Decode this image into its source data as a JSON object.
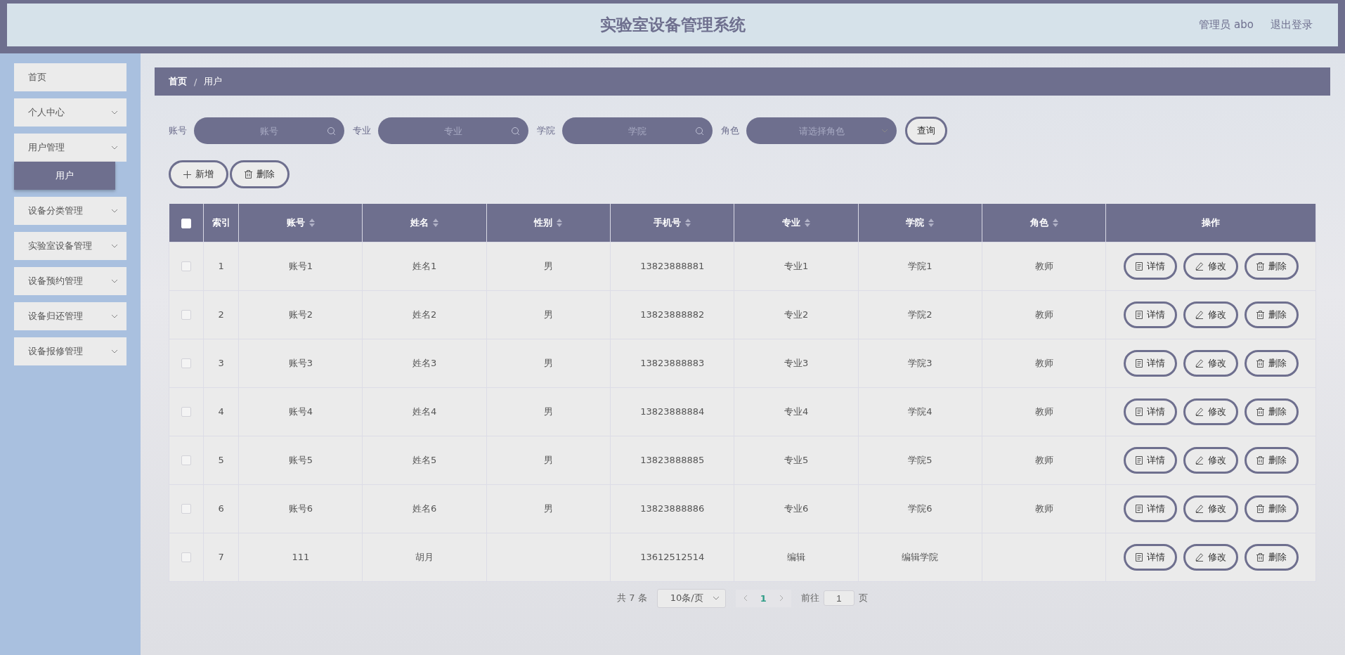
{
  "header": {
    "title": "实验室设备管理系统",
    "user": "管理员 abo",
    "logout": "退出登录"
  },
  "sidebar": {
    "items": [
      {
        "kind": "link",
        "label": "首页"
      },
      {
        "kind": "submenu",
        "label": "个人中心"
      },
      {
        "kind": "submenu",
        "label": "用户管理",
        "children": [
          {
            "label": "用户",
            "selected": true
          }
        ]
      },
      {
        "kind": "submenu",
        "label": "设备分类管理"
      },
      {
        "kind": "submenu",
        "label": "实验室设备管理"
      },
      {
        "kind": "submenu",
        "label": "设备预约管理"
      },
      {
        "kind": "submenu",
        "label": "设备归还管理"
      },
      {
        "kind": "submenu",
        "label": "设备报修管理"
      }
    ]
  },
  "breadcrumb": {
    "items": [
      "首页",
      "用户"
    ],
    "separator": "/"
  },
  "filters": [
    {
      "kind": "text",
      "label": "账号",
      "placeholder": "账号"
    },
    {
      "kind": "text",
      "label": "专业",
      "placeholder": "专业"
    },
    {
      "kind": "text",
      "label": "学院",
      "placeholder": "学院"
    },
    {
      "kind": "select",
      "label": "角色",
      "placeholder": "请选择角色"
    }
  ],
  "search_button": "查询",
  "actions": [
    {
      "kind": "add",
      "label": "新增"
    },
    {
      "kind": "delete",
      "label": "删除"
    }
  ],
  "table": {
    "select_all_checked": false,
    "columns": [
      {
        "label": "索引",
        "sortable": false
      },
      {
        "label": "账号",
        "sortable": true
      },
      {
        "label": "姓名",
        "sortable": true
      },
      {
        "label": "性别",
        "sortable": true
      },
      {
        "label": "手机号",
        "sortable": true
      },
      {
        "label": "专业",
        "sortable": true
      },
      {
        "label": "学院",
        "sortable": true
      },
      {
        "label": "角色",
        "sortable": true
      },
      {
        "label": "操作",
        "sortable": false
      }
    ],
    "rows": [
      {
        "checked": false,
        "cells": [
          "1",
          "账号1",
          "姓名1",
          "男",
          "13823888881",
          "专业1",
          "学院1",
          "教师"
        ],
        "actions": [
          {
            "kind": "detail",
            "label": "详情"
          },
          {
            "kind": "edit",
            "label": "修改"
          },
          {
            "kind": "delete",
            "label": "删除"
          }
        ]
      },
      {
        "checked": false,
        "cells": [
          "2",
          "账号2",
          "姓名2",
          "男",
          "13823888882",
          "专业2",
          "学院2",
          "教师"
        ],
        "actions": [
          {
            "kind": "detail",
            "label": "详情"
          },
          {
            "kind": "edit",
            "label": "修改"
          },
          {
            "kind": "delete",
            "label": "删除"
          }
        ]
      },
      {
        "checked": false,
        "cells": [
          "3",
          "账号3",
          "姓名3",
          "男",
          "13823888883",
          "专业3",
          "学院3",
          "教师"
        ],
        "actions": [
          {
            "kind": "detail",
            "label": "详情"
          },
          {
            "kind": "edit",
            "label": "修改"
          },
          {
            "kind": "delete",
            "label": "删除"
          }
        ]
      },
      {
        "checked": false,
        "cells": [
          "4",
          "账号4",
          "姓名4",
          "男",
          "13823888884",
          "专业4",
          "学院4",
          "教师"
        ],
        "actions": [
          {
            "kind": "detail",
            "label": "详情"
          },
          {
            "kind": "edit",
            "label": "修改"
          },
          {
            "kind": "delete",
            "label": "删除"
          }
        ]
      },
      {
        "checked": false,
        "cells": [
          "5",
          "账号5",
          "姓名5",
          "男",
          "13823888885",
          "专业5",
          "学院5",
          "教师"
        ],
        "actions": [
          {
            "kind": "detail",
            "label": "详情"
          },
          {
            "kind": "edit",
            "label": "修改"
          },
          {
            "kind": "delete",
            "label": "删除"
          }
        ]
      },
      {
        "checked": false,
        "cells": [
          "6",
          "账号6",
          "姓名6",
          "男",
          "13823888886",
          "专业6",
          "学院6",
          "教师"
        ],
        "actions": [
          {
            "kind": "detail",
            "label": "详情"
          },
          {
            "kind": "edit",
            "label": "修改"
          },
          {
            "kind": "delete",
            "label": "删除"
          }
        ]
      },
      {
        "checked": false,
        "cells": [
          "7",
          "111",
          "胡月",
          "",
          "13612512514",
          "编辑",
          "编辑学院",
          ""
        ],
        "actions": [
          {
            "kind": "detail",
            "label": "详情"
          },
          {
            "kind": "edit",
            "label": "修改"
          },
          {
            "kind": "delete",
            "label": "删除"
          }
        ]
      }
    ]
  },
  "pagination": {
    "total": "共 7 条",
    "page_size": "10条/页",
    "pages": [
      {
        "label": "1",
        "selected": true
      }
    ],
    "goto_label": "前往",
    "goto_value": "1",
    "page_suffix": "页"
  }
}
